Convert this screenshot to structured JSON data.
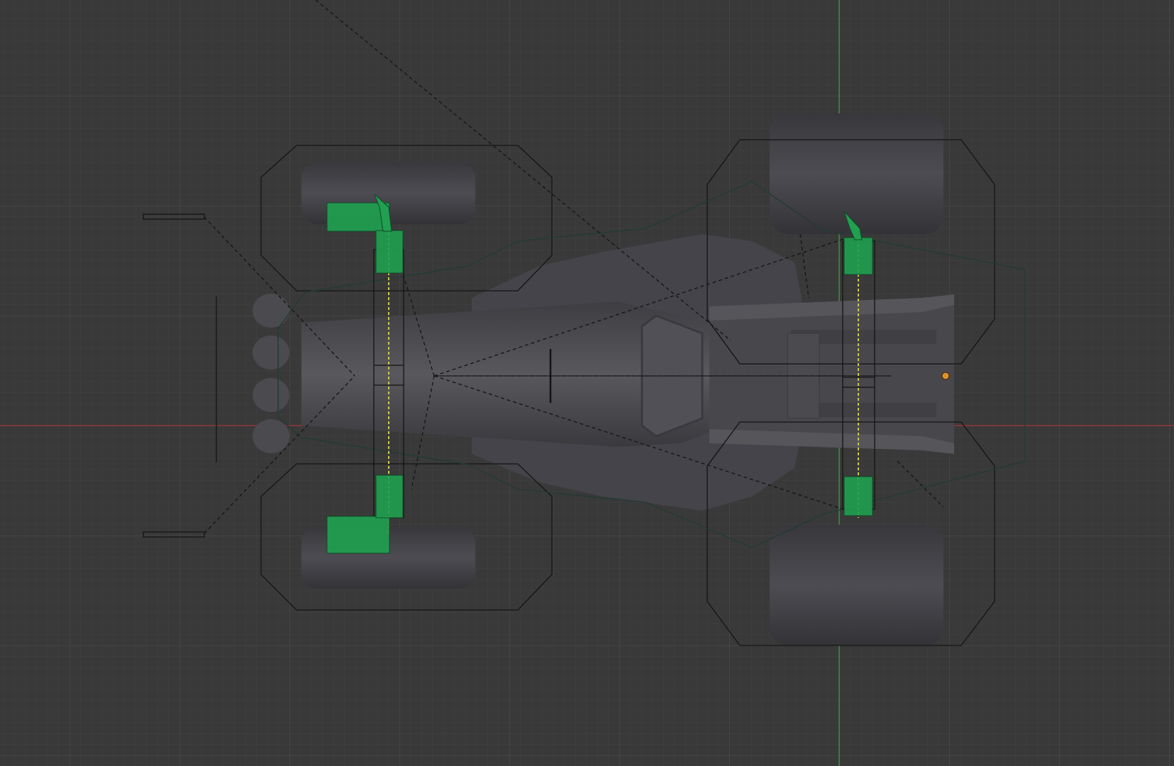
{
  "viewport": {
    "view": "top-orthographic",
    "background_color": "#393939",
    "grid_minor_color": "#414141",
    "grid_major_color": "#4a4a4a",
    "x_axis_color": "#a33535",
    "y_axis_color": "#3f9a3f",
    "model_color": "#4a4a4f",
    "tire_color": "#414146",
    "wire_color": "#121212",
    "selected_bone_color": "#20a050",
    "bone_color": "#c8c850",
    "origin_color": "#e0902a"
  },
  "scene": {
    "object": "buggy-chassis",
    "wheels": [
      "front-left",
      "front-right",
      "rear-left",
      "rear-right"
    ],
    "selected": "suspension-bones"
  }
}
